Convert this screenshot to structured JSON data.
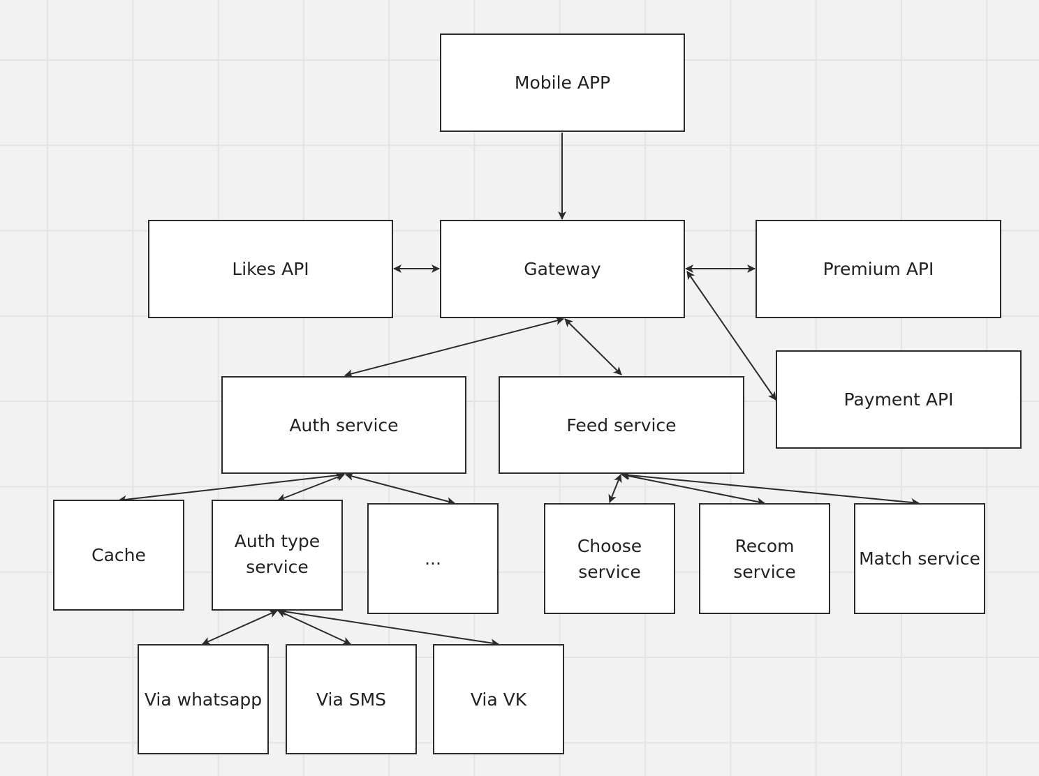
{
  "nodes": {
    "mobile_app": "Mobile APP",
    "likes_api": "Likes API",
    "gateway": "Gateway",
    "premium_api": "Premium API",
    "payment_api": "Payment API",
    "auth_service": "Auth service",
    "feed_service": "Feed service",
    "cache": "Cache",
    "auth_type_service": "Auth type service",
    "ellipsis": "...",
    "choose_service": "Choose service",
    "recom_service": "Recom service",
    "match_service": "Match service",
    "via_whatsapp": "Via whatsapp",
    "via_sms": "Via SMS",
    "via_vk": "Via VK"
  },
  "edges": [
    {
      "from": "mobile_app",
      "to": "gateway",
      "direction": "one-way"
    },
    {
      "from": "likes_api",
      "to": "gateway",
      "direction": "both"
    },
    {
      "from": "gateway",
      "to": "premium_api",
      "direction": "both"
    },
    {
      "from": "gateway",
      "to": "payment_api",
      "direction": "both"
    },
    {
      "from": "gateway",
      "to": "auth_service",
      "direction": "both"
    },
    {
      "from": "gateway",
      "to": "feed_service",
      "direction": "both"
    },
    {
      "from": "auth_service",
      "to": "cache",
      "direction": "both"
    },
    {
      "from": "auth_service",
      "to": "auth_type_service",
      "direction": "both"
    },
    {
      "from": "auth_service",
      "to": "ellipsis",
      "direction": "both"
    },
    {
      "from": "feed_service",
      "to": "choose_service",
      "direction": "both"
    },
    {
      "from": "feed_service",
      "to": "recom_service",
      "direction": "both"
    },
    {
      "from": "feed_service",
      "to": "match_service",
      "direction": "both"
    },
    {
      "from": "auth_type_service",
      "to": "via_whatsapp",
      "direction": "both"
    },
    {
      "from": "auth_type_service",
      "to": "via_sms",
      "direction": "both"
    },
    {
      "from": "auth_type_service",
      "to": "via_vk",
      "direction": "both"
    }
  ],
  "colors": {
    "background": "#f2f2f2",
    "grid": "#e4e4e4",
    "stroke": "#2b2b2b",
    "node_fill": "#ffffff"
  }
}
